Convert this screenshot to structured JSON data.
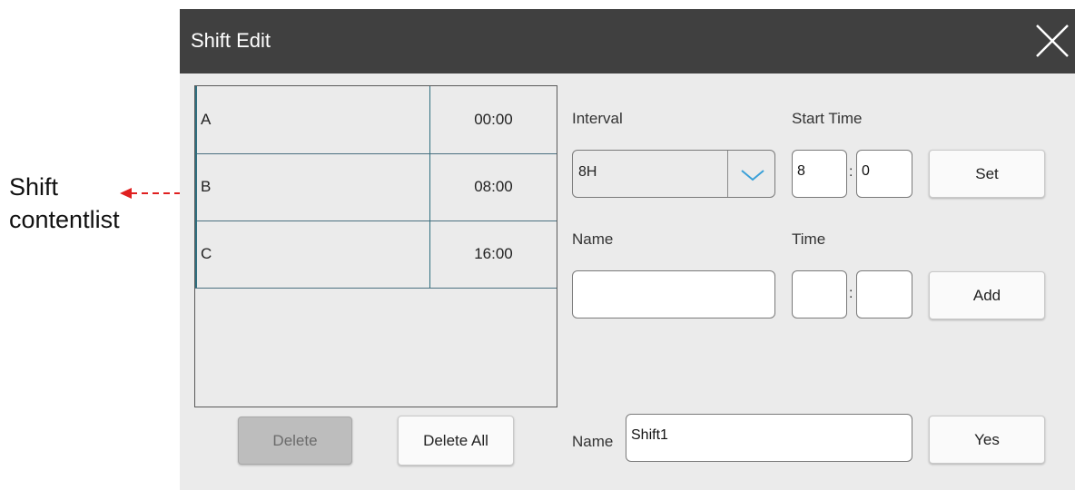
{
  "annotation": {
    "line1": "Shift",
    "line2": "contentlist"
  },
  "dialog": {
    "title": "Shift Edit"
  },
  "shifts": [
    {
      "name": "A",
      "time": "00:00"
    },
    {
      "name": "B",
      "time": "08:00"
    },
    {
      "name": "C",
      "time": "16:00"
    }
  ],
  "list_buttons": {
    "delete": "Delete",
    "delete_all": "Delete All"
  },
  "interval": {
    "label": "Interval",
    "value": "8H"
  },
  "start_time": {
    "label": "Start Time",
    "hour": "8",
    "minute": "0",
    "separator": ":"
  },
  "set_button": "Set",
  "add_section": {
    "name_label": "Name",
    "time_label": "Time",
    "name_value": "",
    "hour": "",
    "minute": "",
    "separator": ":"
  },
  "add_button": "Add",
  "footer": {
    "name_label": "Name",
    "name_value": "Shift1",
    "yes_button": "Yes"
  },
  "colors": {
    "titlebar": "#404040",
    "dialog_bg": "#ebebeb",
    "accent": "#3aa0d8",
    "annotation_arrow": "#e02020"
  }
}
